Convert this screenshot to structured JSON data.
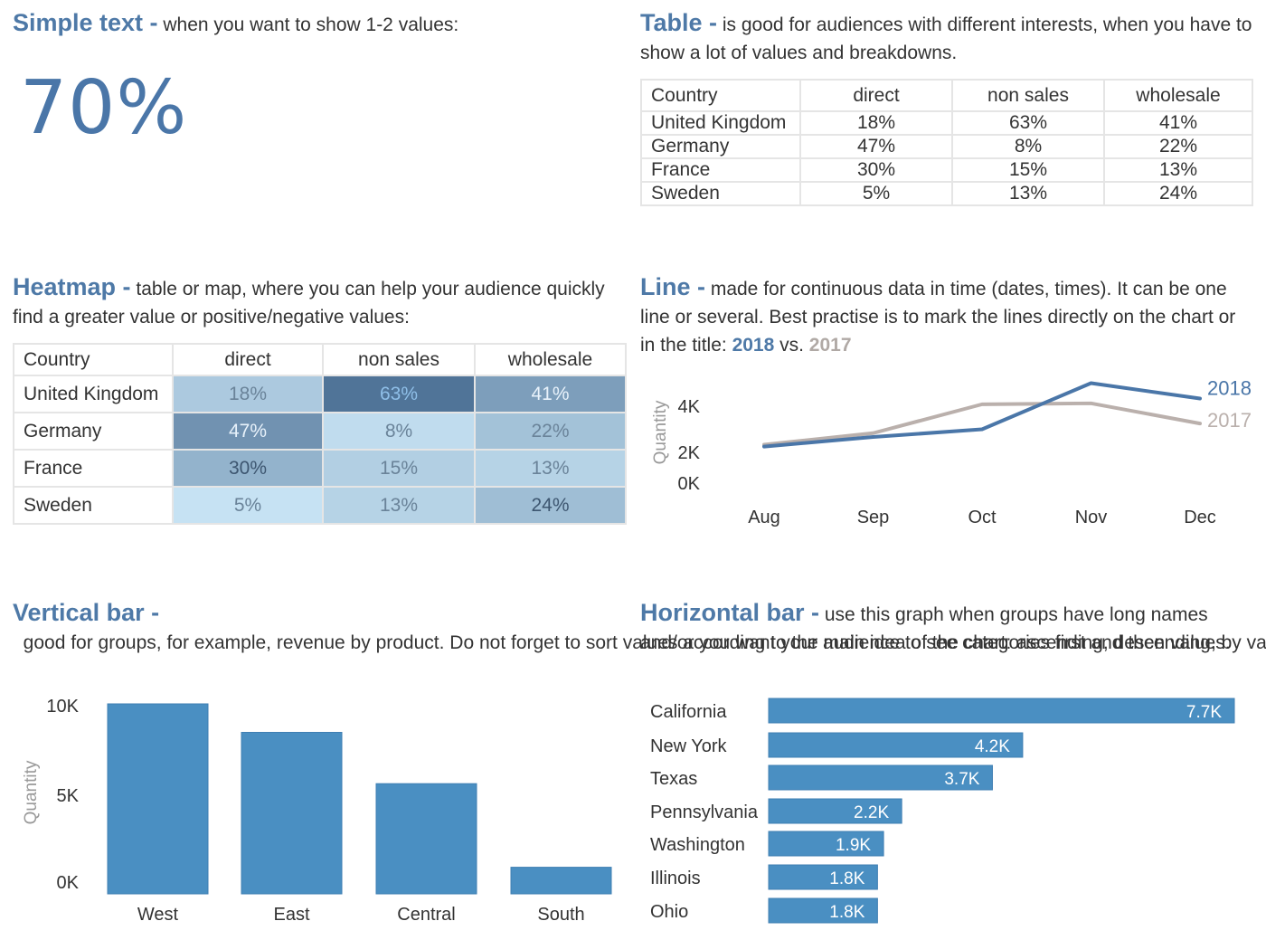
{
  "colors": {
    "title_blue": "#4e79a7",
    "bar_blue": "#4a8fc2",
    "line_2018": "#4a76a8",
    "line_2017": "#bab0ac",
    "text": "#333333",
    "axis_label": "#999999"
  },
  "simple_text": {
    "title": "Simple text -",
    "description": " when you want to show 1-2 values:",
    "value": "70%"
  },
  "table": {
    "title": "Table -",
    "description": " is good for audiences with different interests, when you have to show a lot of values and breakdowns.",
    "headers": [
      "Country",
      "direct",
      "non sales",
      "wholesale"
    ],
    "rows": [
      {
        "country": "United Kingdom",
        "direct": "18%",
        "non_sales": "63%",
        "wholesale": "41%"
      },
      {
        "country": "Germany",
        "direct": "47%",
        "non_sales": "8%",
        "wholesale": "22%"
      },
      {
        "country": "France",
        "direct": "30%",
        "non_sales": "15%",
        "wholesale": "13%"
      },
      {
        "country": "Sweden",
        "direct": "5%",
        "non_sales": "13%",
        "wholesale": "24%"
      }
    ]
  },
  "heatmap": {
    "title": "Heatmap -",
    "description": " table or map, where you can help your audience quickly find a greater value or positive/negative values:",
    "headers": [
      "Country",
      "direct",
      "non sales",
      "wholesale"
    ],
    "rows": [
      {
        "country": "United Kingdom",
        "direct": "18%",
        "non_sales": "63%",
        "wholesale": "41%"
      },
      {
        "country": "Germany",
        "direct": "47%",
        "non_sales": "8%",
        "wholesale": "22%"
      },
      {
        "country": "France",
        "direct": "30%",
        "non_sales": "15%",
        "wholesale": "13%"
      },
      {
        "country": "Sweden",
        "direct": "5%",
        "non_sales": "13%",
        "wholesale": "24%"
      }
    ]
  },
  "line": {
    "title": "Line -",
    "description_1": " made for continuous data in time (dates, times). It can be one line or several. Best practise is to mark the lines directly on the chart or in the title: ",
    "label_2018": "2018",
    "vs": " vs. ",
    "label_2017": "2017"
  },
  "vertical_bar": {
    "title": "Vertical bar -",
    "description": "  good for groups, for example, revenue by product. Do not forget to sort values according to the main idea of the chart: ascending, descending, by value or by category."
  },
  "horizontal_bar": {
    "title": "Horizontal bar -",
    "description": " use this graph when groups have long names and/or you want your audience to see categories first and then values."
  },
  "chart_data": [
    {
      "id": "heatmap",
      "type": "heatmap",
      "title": "Heatmap",
      "x": [
        "direct",
        "non sales",
        "wholesale"
      ],
      "y": [
        "United Kingdom",
        "Germany",
        "France",
        "Sweden"
      ],
      "values": [
        [
          18,
          63,
          41
        ],
        [
          47,
          8,
          22
        ],
        [
          30,
          15,
          13
        ],
        [
          5,
          13,
          24
        ]
      ],
      "unit": "%"
    },
    {
      "id": "line",
      "type": "line",
      "title": "2018 vs. 2017",
      "xlabel": "",
      "ylabel": "Quantity",
      "categories": [
        "Aug",
        "Sep",
        "Oct",
        "Nov",
        "Dec"
      ],
      "yticks": [
        "0K",
        "2K",
        "4K"
      ],
      "ylim": [
        0,
        5500
      ],
      "series": [
        {
          "name": "2018",
          "values": [
            1900,
            2400,
            2800,
            5200,
            4400
          ]
        },
        {
          "name": "2017",
          "values": [
            2000,
            2600,
            4100,
            4150,
            3100
          ]
        }
      ],
      "legend": "direct-labels-right",
      "grid": false
    },
    {
      "id": "vertical_bar",
      "type": "bar",
      "title": "",
      "xlabel": "",
      "ylabel": "Quantity",
      "categories": [
        "West",
        "East",
        "Central",
        "South"
      ],
      "values": [
        10000,
        8500,
        5800,
        1400
      ],
      "yticks": [
        "0K",
        "5K",
        "10K"
      ],
      "ylim": [
        0,
        10000
      ],
      "grid": false
    },
    {
      "id": "horizontal_bar",
      "type": "bar",
      "orientation": "horizontal",
      "title": "",
      "categories": [
        "California",
        "New York",
        "Texas",
        "Pennsylvania",
        "Washington",
        "Illinois",
        "Ohio"
      ],
      "values": [
        7700,
        4200,
        3700,
        2200,
        1900,
        1800,
        1800
      ],
      "value_labels": [
        "7.7K",
        "4.2K",
        "3.7K",
        "2.2K",
        "1.9K",
        "1.8K",
        "1.8K"
      ],
      "xlim": [
        0,
        7700
      ],
      "grid": false
    }
  ]
}
